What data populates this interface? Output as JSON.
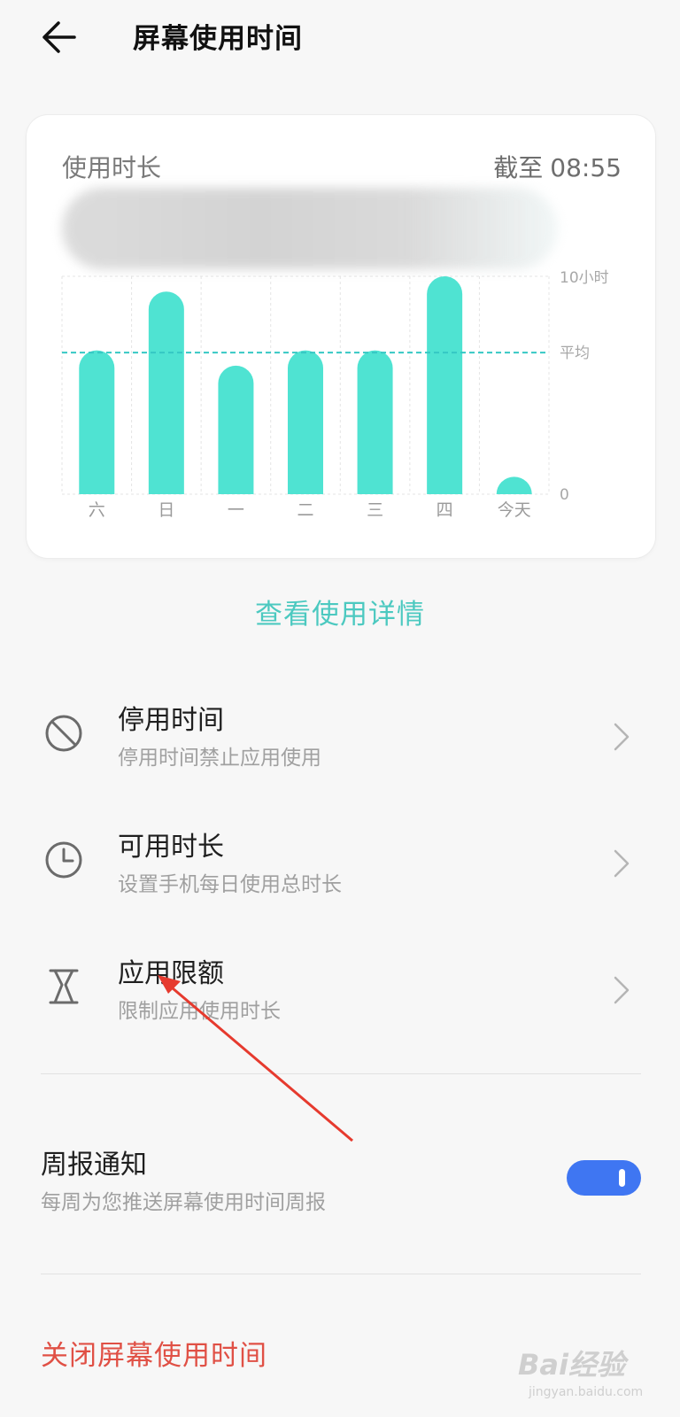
{
  "header": {
    "title": "屏幕使用时间",
    "back_icon": "arrow-left-icon"
  },
  "card": {
    "title": "使用时长",
    "as_of_label": "截至",
    "as_of_time": "08:55"
  },
  "chart_data": {
    "type": "bar",
    "categories": [
      "六",
      "日",
      "一",
      "二",
      "三",
      "四",
      "今天"
    ],
    "values": [
      6.6,
      9.3,
      5.9,
      6.6,
      6.6,
      10.0,
      0.8
    ],
    "average": 6.5,
    "ylim": [
      0,
      10
    ],
    "y_tick_labels": {
      "max": "10小时",
      "average": "平均",
      "min": "0"
    },
    "bar_color": "#4fe3d2",
    "average_line_color": "#35c8c4"
  },
  "detail_link": "查看使用详情",
  "menu": [
    {
      "label": "停用时间",
      "sub": "停用时间禁止应用使用",
      "icon": "prohibit-icon"
    },
    {
      "label": "可用时长",
      "sub": "设置手机每日使用总时长",
      "icon": "clock-icon"
    },
    {
      "label": "应用限额",
      "sub": "限制应用使用时长",
      "icon": "hourglass-icon"
    }
  ],
  "weekly_report": {
    "label": "周报通知",
    "sub": "每周为您推送屏幕使用时间周报",
    "enabled": true
  },
  "turn_off": "关闭屏幕使用时间",
  "watermark": {
    "text": "Bai经验",
    "url": "jingyan.baidu.com"
  },
  "colors": {
    "accent": "#4cc9c0",
    "danger": "#e05045",
    "toggle_on": "#3f76f2"
  }
}
